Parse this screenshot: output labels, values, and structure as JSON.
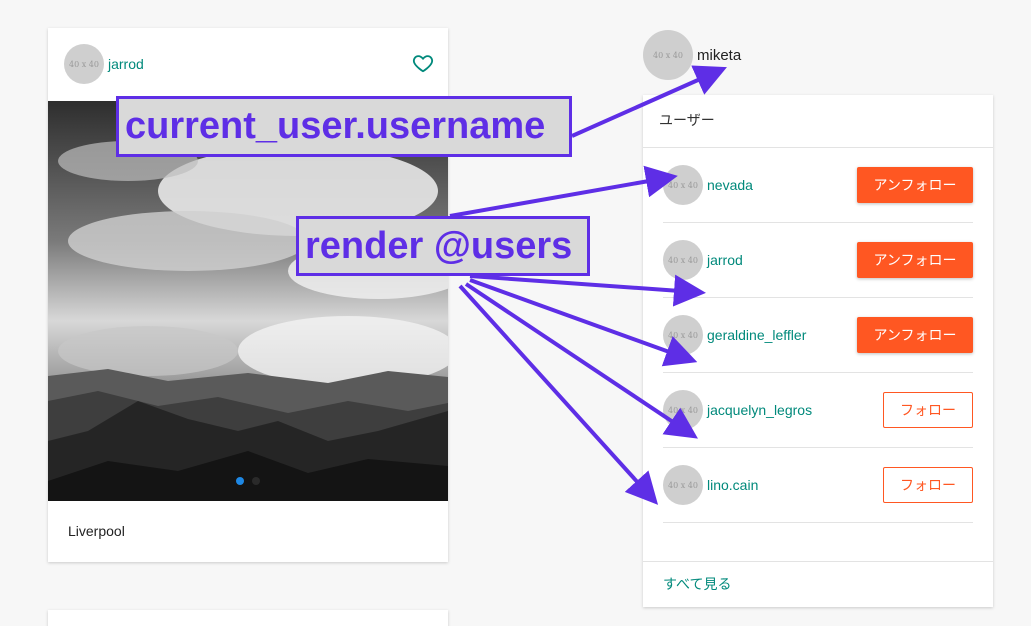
{
  "post": {
    "avatar_text": "40 x 40",
    "username": "jarrod",
    "caption": "Liverpool",
    "carousel_dots": 2,
    "active_dot": 1
  },
  "current_user": {
    "avatar_text": "40 x 40",
    "username": "miketa"
  },
  "users_panel": {
    "title": "ユーザー",
    "see_all": "すべて見る",
    "users": [
      {
        "avatar_text": "40 x 40",
        "username": "nevada",
        "action": "アンフォロー",
        "state": "following"
      },
      {
        "avatar_text": "40 x 40",
        "username": "jarrod",
        "action": "アンフォロー",
        "state": "following"
      },
      {
        "avatar_text": "40 x 40",
        "username": "geraldine_leffler",
        "action": "アンフォロー",
        "state": "following"
      },
      {
        "avatar_text": "40 x 40",
        "username": "jacquelyn_legros",
        "action": "フォロー",
        "state": "not-following"
      },
      {
        "avatar_text": "40 x 40",
        "username": "lino.cain",
        "action": "フォロー",
        "state": "not-following"
      }
    ]
  },
  "annotations": {
    "current_user_label": "current_user.username",
    "render_users_label": "render @users"
  },
  "colors": {
    "accent_teal": "#00897b",
    "unfollow_orange": "#ff5722",
    "annotation_purple": "#5e2ee6"
  },
  "icons": {
    "like": "heart-icon",
    "carousel": "carousel-dot-icon"
  }
}
